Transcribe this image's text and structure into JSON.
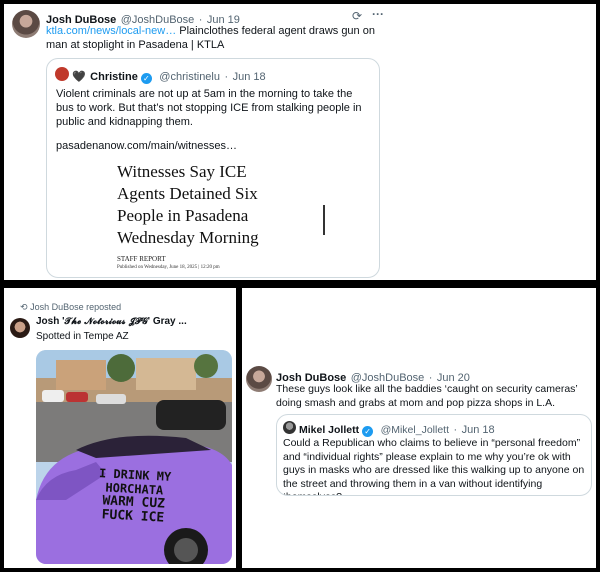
{
  "tweet1": {
    "author": "Josh DuBose",
    "handle": "@JoshDuBose",
    "sep": "·",
    "date": "Jun 19",
    "link": "ktla.com/news/local-new…",
    "text": " Plainclothes federal agent draws gun on man at stoplight in Pasadena | KTLA",
    "quote": {
      "author": "Christine",
      "handle": "@christinelu",
      "sep": "·",
      "date": "Jun 18",
      "text": "Violent criminals are not up at 5am in the morning to take the bus to work. But that’s not stopping ICE from stalking people in public and kidnapping them.",
      "link": "pasadenanow.com/main/witnesses…",
      "article": {
        "headline_lines": [
          "Witnesses Say ICE",
          "Agents Detained Six",
          "People in Pasadena",
          "Wednesday Morning"
        ],
        "byline": "STAFF REPORT",
        "published": "Published on Wednesday, June 18, 2025 | 12:20 pm"
      }
    }
  },
  "tweet2": {
    "repost_label": "Josh DuBose reposted",
    "author_prefix": "Josh '",
    "author_styled": "𝓣𝓱𝓮 𝓝𝓸𝓽𝓸𝓻𝓲𝓸𝓾𝓼 𝓙𝓟𝓖",
    "author_suffix": "' Gray ...",
    "text": "Spotted in Tempe AZ",
    "car_text_lines": [
      "I DRINK MY HORCHATA",
      "WARM CUZ",
      "FUCK ICE"
    ]
  },
  "tweet3": {
    "author": "Josh DuBose",
    "handle": "@JoshDuBose",
    "sep": "·",
    "date": "Jun 20",
    "text": "These guys look like all the baddies ‘caught on security cameras’ doing smash and grabs at mom and pop pizza shops in L.A.",
    "quote": {
      "author": "Mikel Jollett",
      "handle": "@Mikel_Jollett",
      "sep": "·",
      "date": "Jun 18",
      "text": "Could a Republican who claims to believe in “personal freedom” and “individual rights” please explain to me why you’re ok with guys in masks who are dressed like this walking up to anyone on the street and throwing them in a van without identifying themselves?"
    }
  },
  "colors": {
    "accent": "#1d9bf0",
    "car": "#9b6fe0",
    "secondary_text": "#536471"
  }
}
